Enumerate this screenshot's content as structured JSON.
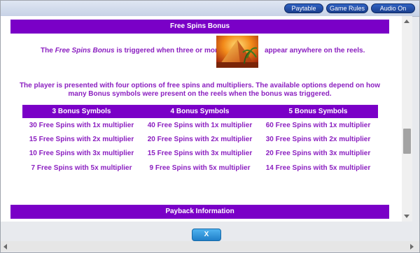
{
  "top_buttons": {
    "paytable": "Paytable",
    "game_rules": "Game Rules",
    "audio": "Audio On"
  },
  "free_spins": {
    "header": "Free Spins Bonus",
    "intro_before_em": "The ",
    "intro_em": "Free Spins Bonus",
    "intro_after_em": " is triggered when three or more",
    "intro_after_image": "appear anywhere on the reels.",
    "paragraph": "The player is presented with four options of free spins and multipliers. The available options depend on how many Bonus symbols were present on the reels when the bonus was triggered."
  },
  "bonus_table": {
    "columns": [
      "3 Bonus Symbols",
      "4 Bonus Symbols",
      "5 Bonus Symbols"
    ],
    "rows": [
      [
        "30 Free Spins with 1x multiplier",
        "40 Free Spins with 1x multiplier",
        "60 Free Spins with 1x multiplier"
      ],
      [
        "15 Free Spins with 2x multiplier",
        "20 Free Spins with 2x multiplier",
        "30 Free Spins with 2x multiplier"
      ],
      [
        "10 Free Spins with 3x multiplier",
        "15 Free Spins with 3x multiplier",
        "20 Free Spins with 3x multiplier"
      ],
      [
        "7 Free Spins with 5x multiplier",
        "9 Free Spins with 5x multiplier",
        "14 Free Spins with 5x multiplier"
      ]
    ]
  },
  "payback": {
    "header": "Payback Information"
  },
  "footer": {
    "close_label": "X"
  },
  "colors": {
    "header_purple": "#7a00c7",
    "text_purple": "#8b1fc0",
    "button_blue": "#1f7fc9"
  }
}
